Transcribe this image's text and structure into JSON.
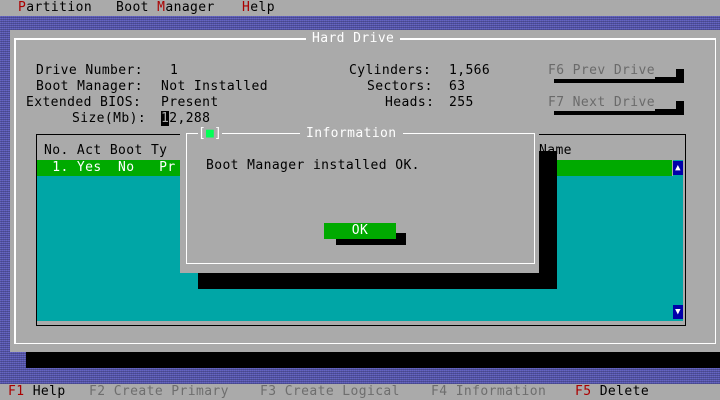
{
  "menubar": {
    "items": [
      {
        "hotkey": "P",
        "rest": "artition"
      },
      {
        "pre": "Boot ",
        "hotkey": "M",
        "rest": "anager"
      },
      {
        "hotkey": "H",
        "rest": "elp"
      }
    ]
  },
  "window": {
    "title": "Hard Drive",
    "labels": {
      "drive_number": "Drive Number:",
      "boot_manager": "Boot Manager:",
      "extended_bios": "Extended BIOS:",
      "size": "Size(Mb):",
      "cylinders": "Cylinders:",
      "sectors": "Sectors:",
      "heads": "Heads:"
    },
    "values": {
      "drive_number": "1",
      "boot_manager": "Not Installed",
      "extended_bios": "Present",
      "size_cursor": "1",
      "size_rest": "2,288",
      "cylinders": "1,566",
      "sectors": "63",
      "heads": "255"
    },
    "buttons": {
      "prev_drive": "F6 Prev Drive",
      "next_drive": "F7 Next Drive"
    }
  },
  "partition_table": {
    "header_left": "No. Act Boot Ty",
    "header_right": "Name",
    "rows": [
      {
        "text_left": " 1. Yes  No   Pr"
      }
    ],
    "scroll_up": "▲",
    "scroll_down": "▼"
  },
  "dialog": {
    "close_left": "[",
    "close_dot": "■",
    "close_right": "]",
    "title": "Information",
    "message": "Boot Manager installed OK.",
    "ok_label": "OK"
  },
  "statusbar": {
    "items": [
      {
        "key": "F1",
        "label": "Help",
        "enabled": true
      },
      {
        "key": "F2",
        "label": "Create Primary",
        "enabled": false
      },
      {
        "key": "F3",
        "label": "Create Logical",
        "enabled": false
      },
      {
        "key": "F4",
        "label": "Information",
        "enabled": false
      },
      {
        "key": "F5",
        "label": "Delete",
        "enabled": true
      }
    ]
  }
}
